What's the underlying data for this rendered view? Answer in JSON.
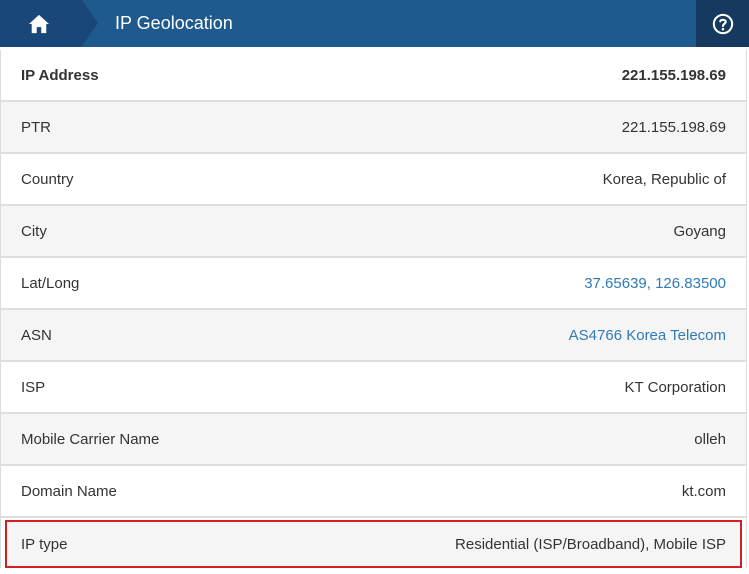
{
  "header": {
    "title": "IP Geolocation",
    "home_icon": "home-icon",
    "help_icon": "help-icon"
  },
  "colors": {
    "header_bg": "#1f5a8e",
    "link": "#2f7ab8",
    "highlight_border": "#d21f1f"
  },
  "rows": [
    {
      "label": "IP Address",
      "value": "221.155.198.69"
    },
    {
      "label": "PTR",
      "value": "221.155.198.69"
    },
    {
      "label": "Country",
      "value": "Korea, Republic of"
    },
    {
      "label": "City",
      "value": "Goyang"
    },
    {
      "label": "Lat/Long",
      "value": "37.65639, 126.83500"
    },
    {
      "label": "ASN",
      "value": "AS4766 Korea Telecom"
    },
    {
      "label": "ISP",
      "value": "KT Corporation"
    },
    {
      "label": "Mobile Carrier Name",
      "value": "olleh"
    },
    {
      "label": "Domain Name",
      "value": "kt.com"
    },
    {
      "label": "IP type",
      "value": "Residential (ISP/Broadband), Mobile ISP"
    }
  ]
}
